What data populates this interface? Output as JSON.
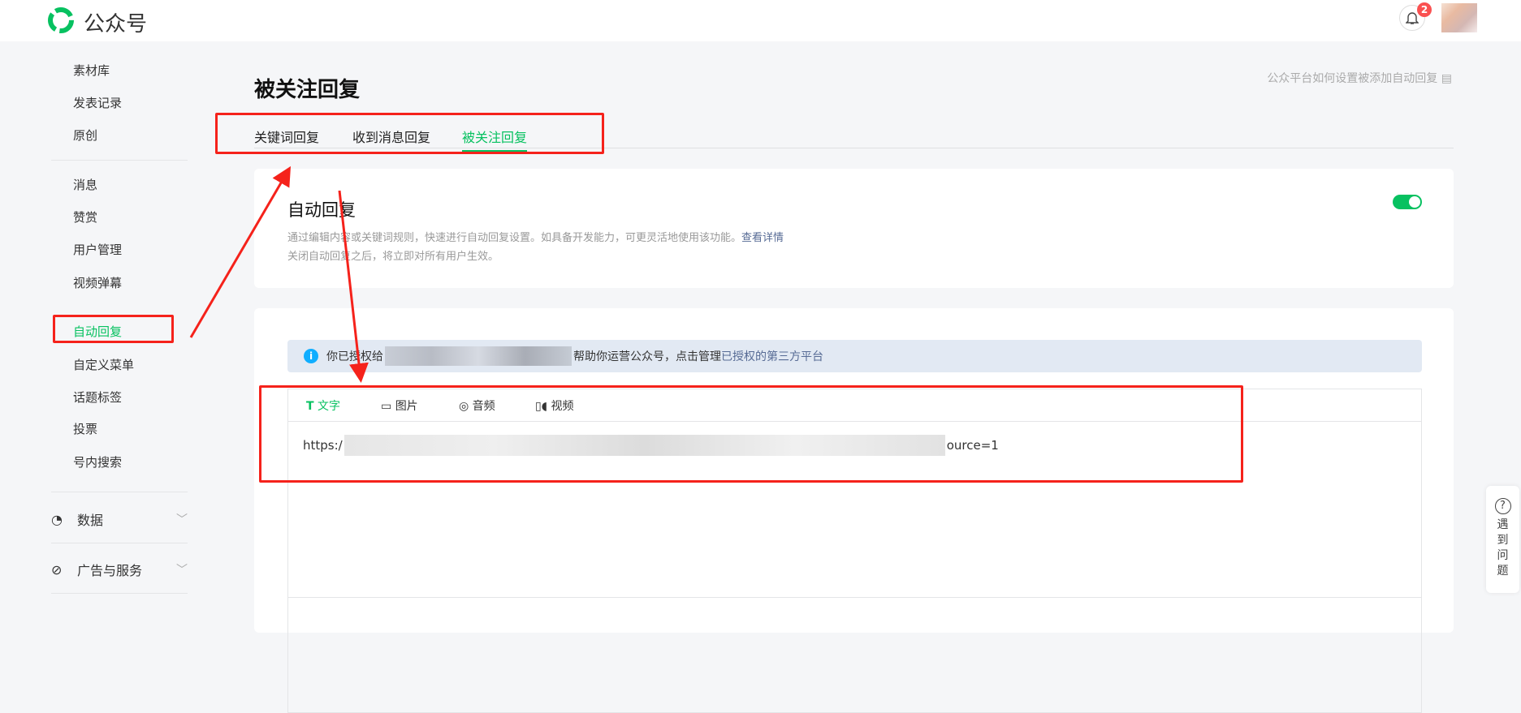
{
  "header": {
    "brand": "公众号",
    "notification_count": "2"
  },
  "sidebar": {
    "items": [
      "素材库",
      "发表记录",
      "原创",
      "消息",
      "赞赏",
      "用户管理",
      "视频弹幕",
      "自动回复",
      "自定义菜单",
      "话题标签",
      "投票",
      "号内搜索"
    ],
    "active": "自动回复",
    "groups": [
      "数据",
      "广告与服务"
    ]
  },
  "page": {
    "title": "被关注回复",
    "help_link": "公众平台如何设置被添加自动回复"
  },
  "tabs": [
    "关键词回复",
    "收到消息回复",
    "被关注回复"
  ],
  "auto_reply": {
    "title": "自动回复",
    "desc1": "通过编辑内容或关键词规则，快速进行自动回复设置。如具备开发能力，可更灵活地使用该功能。",
    "desc1_link": "查看详情",
    "desc2": "关闭自动回复之后，将立即对所有用户生效。",
    "enabled": true
  },
  "notice": {
    "prefix": "你已授权给",
    "suffix": "帮助你运营公众号，点击管理",
    "link": "已授权的第三方平台"
  },
  "editor": {
    "tools": [
      "文字",
      "图片",
      "音频",
      "视频"
    ],
    "content_prefix": "https:/",
    "content_suffix": "ource=1"
  },
  "float_help": {
    "icon": "?",
    "label": [
      "遇",
      "到",
      "问",
      "题"
    ]
  },
  "colors": {
    "accent": "#07c160",
    "annotation": "#f5221b"
  }
}
